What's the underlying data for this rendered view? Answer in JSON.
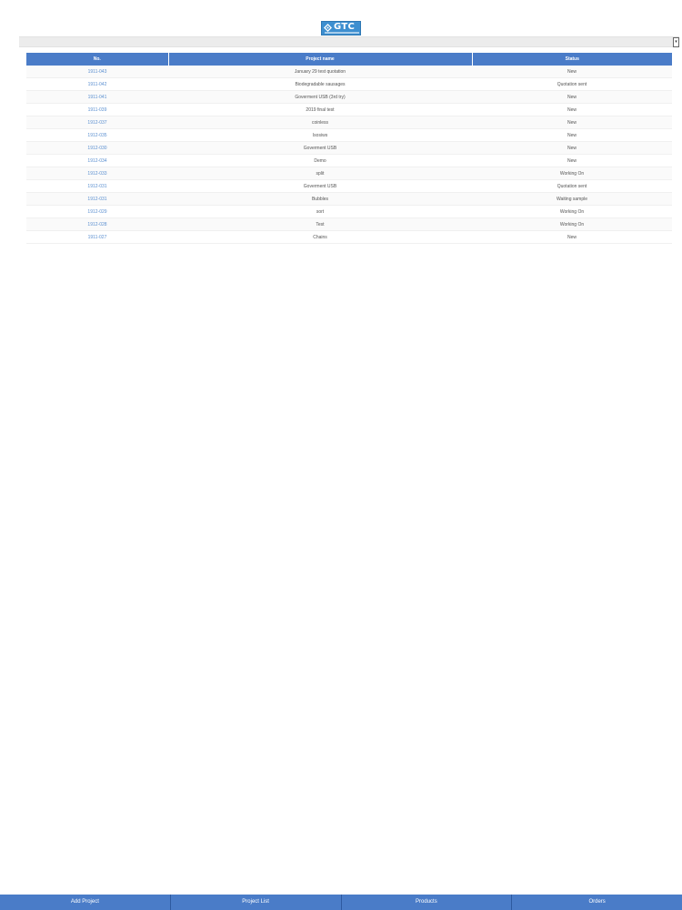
{
  "logo": {
    "text": "GTC"
  },
  "table": {
    "headers": [
      "No.",
      "Project name",
      "Status"
    ],
    "rows": [
      {
        "no": "1911-043",
        "name": "January 29 test quotation",
        "status": "New"
      },
      {
        "no": "1911-042",
        "name": "Biodegradable sausages",
        "status": "Quotation sent"
      },
      {
        "no": "1911-041",
        "name": "Goverment USB (3rd try)",
        "status": "New"
      },
      {
        "no": "1911-039",
        "name": "2019 final test",
        "status": "New"
      },
      {
        "no": "1912-037",
        "name": "coinless",
        "status": "New"
      },
      {
        "no": "1912-035",
        "name": "Isosiws",
        "status": "New"
      },
      {
        "no": "1912-030",
        "name": "Goverment USB",
        "status": "New"
      },
      {
        "no": "1912-034",
        "name": "Demo",
        "status": "New"
      },
      {
        "no": "1912-033",
        "name": "split",
        "status": "Working On"
      },
      {
        "no": "1912-031",
        "name": "Goverment USB",
        "status": "Quotation sent"
      },
      {
        "no": "1912-031",
        "name": "Bubbles",
        "status": "Waiting sample"
      },
      {
        "no": "1912-029",
        "name": "sort",
        "status": "Working On"
      },
      {
        "no": "1912-028",
        "name": "Test",
        "status": "Working On"
      },
      {
        "no": "1911-027",
        "name": "Chains",
        "status": "New"
      }
    ]
  },
  "nav": {
    "items": [
      "Add Project",
      "Project List",
      "Products",
      "Orders"
    ]
  },
  "colors": {
    "accent": "#4a7cc8",
    "link": "#5a8fd0"
  },
  "icons": {
    "logo_mark": "gtc-logo-icon",
    "menu_toggle": "caret-down-icon"
  }
}
